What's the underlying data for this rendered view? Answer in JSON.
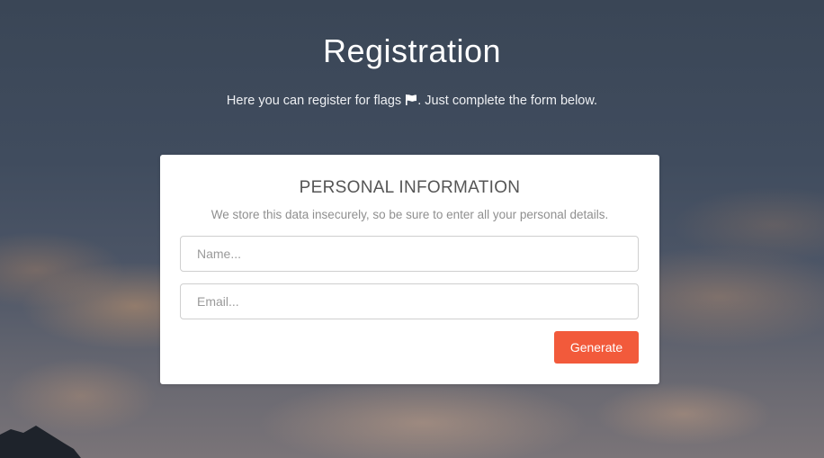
{
  "page": {
    "title": "Registration",
    "subtitle_before": "Here you can register for flags ",
    "subtitle_after": ". Just complete the form below.",
    "subtitle_icon": "flag-icon"
  },
  "card": {
    "heading": "PERSONAL INFORMATION",
    "description": "We store this data insecurely, so be sure to enter all your personal details.",
    "name_field": {
      "value": "",
      "placeholder": "Name..."
    },
    "email_field": {
      "value": "",
      "placeholder": "Email..."
    },
    "generate_label": "Generate"
  },
  "colors": {
    "accent_button": "#f25a3b",
    "card_background": "#ffffff",
    "background_sky": "#3d4a5c"
  }
}
